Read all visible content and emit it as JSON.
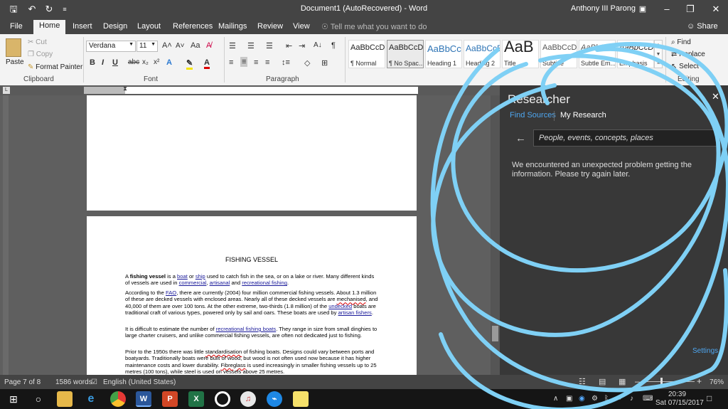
{
  "titlebar": {
    "doc_title": "Document1 (AutoRecovered) - Word",
    "user": "Anthony III Parong"
  },
  "tabs": [
    "File",
    "Home",
    "Insert",
    "Design",
    "Layout",
    "References",
    "Mailings",
    "Review",
    "View"
  ],
  "tell_me": "Tell me what you want to do",
  "share": "Share",
  "ribbon": {
    "clipboard": {
      "paste": "Paste",
      "cut": "Cut",
      "copy": "Copy",
      "format_painter": "Format Painter",
      "label": "Clipboard"
    },
    "font": {
      "name": "Verdana",
      "size": "11",
      "label": "Font"
    },
    "paragraph": {
      "label": "Paragraph"
    },
    "styles": [
      {
        "sample": "AaBbCcDc",
        "name": "¶ Normal"
      },
      {
        "sample": "AaBbCcDc",
        "name": "¶ No Spac..."
      },
      {
        "sample": "AaBbCc",
        "name": "Heading 1"
      },
      {
        "sample": "AaBbCcE",
        "name": "Heading 2"
      },
      {
        "sample": "AaB",
        "name": "Title"
      },
      {
        "sample": "AaBbCcD",
        "name": "Subtitle"
      },
      {
        "sample": "AaBbCcDc",
        "name": "Subtle Em..."
      },
      {
        "sample": "AaBbCcDc",
        "name": "Emphasis"
      }
    ],
    "editing": {
      "find": "Find",
      "replace": "Replace",
      "select": "Select",
      "label": "Editing"
    }
  },
  "document": {
    "heading": "FISHING VESSEL",
    "paragraphs": [
      "A fishing vessel is a boat or ship used to catch fish in the sea, or on a lake or river. Many different kinds of vessels are used in commercial, artisanal and recreational fishing.",
      "According to the FAO, there are currently (2004) four million commercial fishing vessels. About 1.3 million of these are decked vessels with enclosed areas. Nearly all of these decked vessels are mechanised, and 40,000 of them are over 100 tons. At the other extreme, two-thirds (1.8 million) of the undecked boats are traditional craft of various types, powered only by sail and oars. These boats are used by artisan fishers.",
      "It is difficult to estimate the number of recreational fishing boats. They range in size from small dinghies to large charter cruisers, and unlike commercial fishing vessels, are often not dedicated just to fishing.",
      "Prior to the 1950s there was little standardisation of fishing boats. Designs could vary between ports and boatyards. Traditionally boats were built of wood, but wood is not often used now because it has higher maintenance costs and lower durability. Fibreglass is used increasingly in smaller fishing vessels up to 25 metres (100 tons), while steel is used on vessels above 25 metres."
    ]
  },
  "research": {
    "title": "Researcher",
    "tab_find": "Find Sources",
    "tab_my": "My Research",
    "search_placeholder": "People, events, concepts, places",
    "message": "We encountered an unexpected problem getting the information. Please try again later.",
    "settings": "Settings"
  },
  "status": {
    "page": "Page 7 of 8",
    "words": "1586 words",
    "language": "English (United States)",
    "zoom": "76%"
  },
  "taskbar": {
    "time": "20:39",
    "date": "Sat 07/15/2017"
  },
  "colors": {
    "accent_blue": "#4ea6f0",
    "scribble": "#7fd0f5",
    "word_blue": "#2b579a"
  }
}
